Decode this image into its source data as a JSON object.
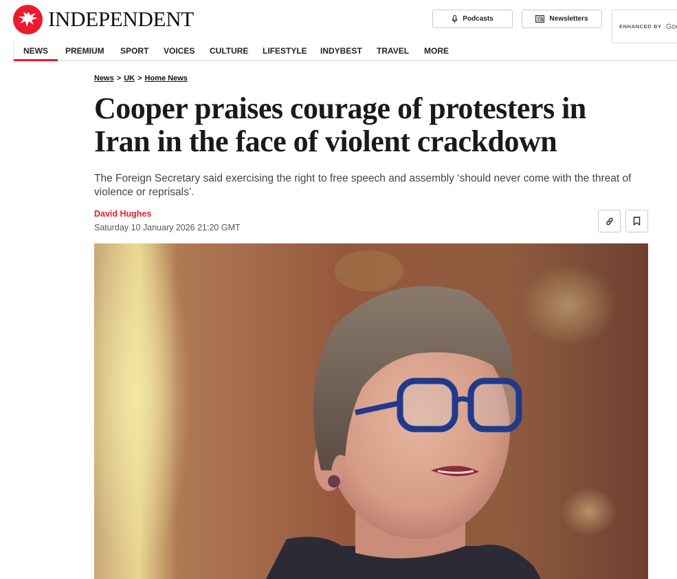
{
  "brand": {
    "name": "INDEPENDENT",
    "accent_color": "#ec1a2e",
    "logo_icon": "eagle-logo-icon"
  },
  "header": {
    "podcasts_label": "Podcasts",
    "podcasts_icon": "microphone-icon",
    "newsletters_label": "Newsletters",
    "newsletters_icon": "newsletter-icon",
    "search": {
      "enhanced_by": "ENHANCED BY",
      "brand_partial": "Goo"
    }
  },
  "nav": {
    "items": [
      {
        "label": "NEWS",
        "active": true
      },
      {
        "label": "PREMIUM"
      },
      {
        "label": "SPORT"
      },
      {
        "label": "VOICES"
      },
      {
        "label": "CULTURE"
      },
      {
        "label": "LIFESTYLE"
      },
      {
        "label": "INDYBEST"
      },
      {
        "label": "TRAVEL"
      },
      {
        "label": "MORE"
      }
    ]
  },
  "breadcrumb": [
    "News",
    "UK",
    "Home News"
  ],
  "article": {
    "headline": "Cooper praises courage of protesters in Iran in the face of violent crackdown",
    "standfirst": "The Foreign Secretary said exercising the right to free speech and assembly ‘should never come with the threat of violence or reprisals’.",
    "author": "David Hughes",
    "date": "Saturday 10 January 2026 21:20 GMT",
    "share_icon": "link-icon",
    "bookmark_icon": "bookmark-icon"
  }
}
